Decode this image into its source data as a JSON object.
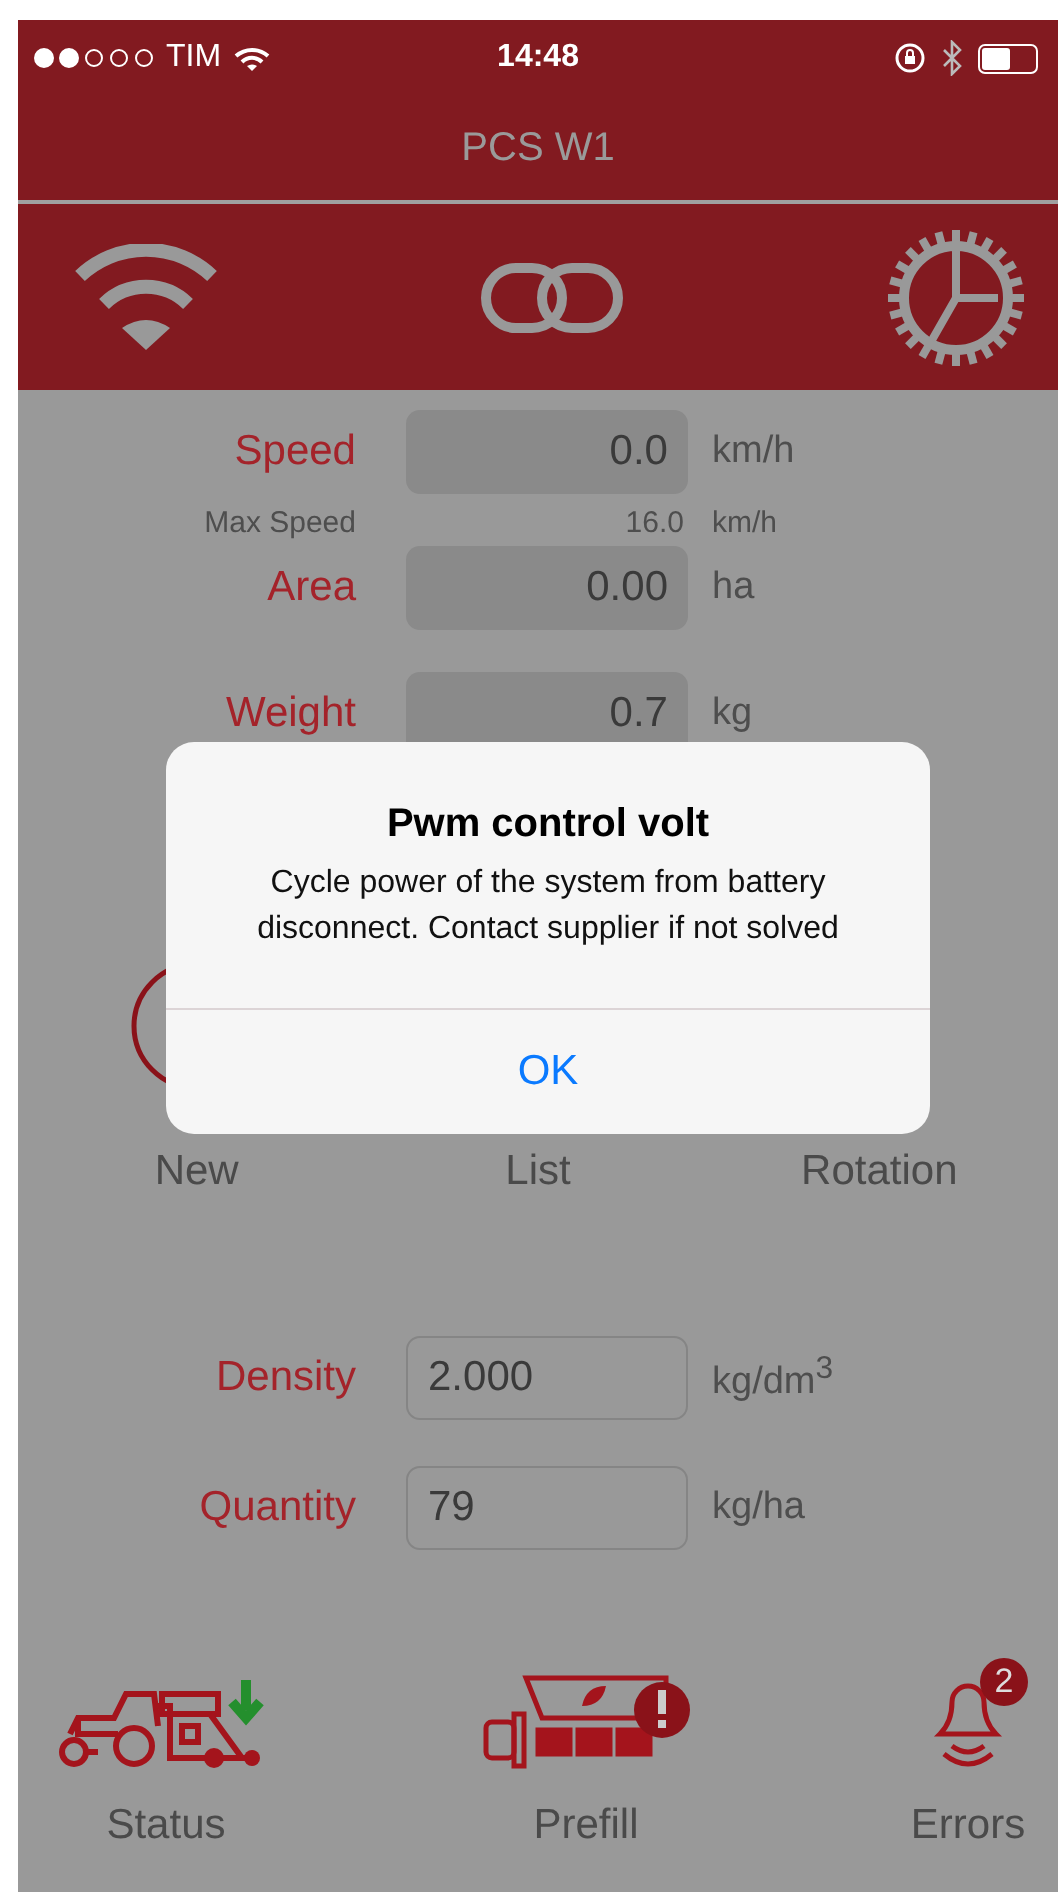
{
  "status_bar": {
    "carrier": "TIM",
    "time": "14:48"
  },
  "nav": {
    "title": "PCS W1"
  },
  "readings": [
    {
      "kind": "field",
      "label": "Speed",
      "value": "0.0",
      "unit": "km/h"
    },
    {
      "kind": "sub",
      "label": "Max Speed",
      "value": "16.0",
      "unit": "km/h"
    },
    {
      "kind": "field",
      "label": "Area",
      "value": "0.00",
      "unit": "ha"
    },
    {
      "kind": "field",
      "label": "Weight",
      "value": "0.7",
      "unit": "kg"
    }
  ],
  "actions": [
    {
      "label": "New"
    },
    {
      "label": "List"
    },
    {
      "label": "Rotation"
    }
  ],
  "inputs": [
    {
      "label": "Density",
      "value": "2.000",
      "unit": "kg/dm$^{3}$"
    },
    {
      "label": "Quantity",
      "value": "79",
      "unit": "kg/ha"
    }
  ],
  "tabs": [
    {
      "label": "Status"
    },
    {
      "label": "Prefill"
    },
    {
      "label": "Errors",
      "badge": "2"
    }
  ],
  "alert": {
    "title": "Pwm control volt",
    "message": "Cycle power of the system from battery disconnect. Contact supplier if not solved",
    "button": "OK"
  }
}
